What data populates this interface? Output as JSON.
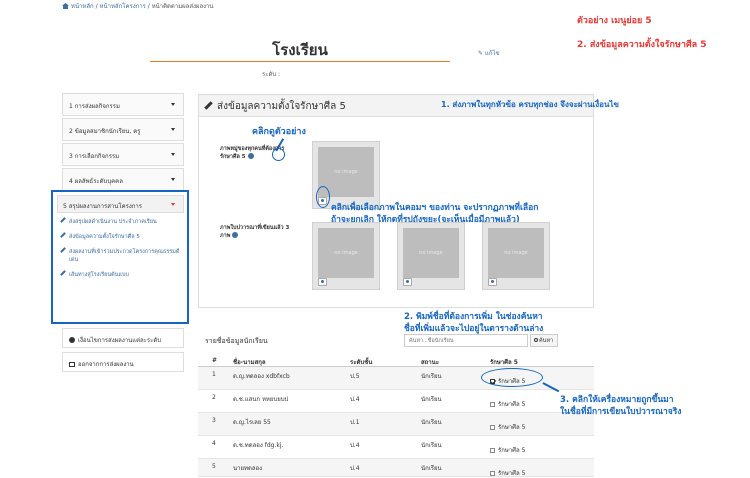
{
  "breadcrumb": {
    "home": "หน้าหลัก",
    "projects": "หน้าหลักโครงการ",
    "current": "หน้าติดตามผลส่งผลงาน",
    "sep": " / "
  },
  "annotations": {
    "example_submenu": "ตัวอย่าง เมนูย่อย 5",
    "step2_top": "2. ส่งข้อมูลความตั้งใจรักษาศีล 5",
    "step1": "1. ส่งภาพในทุกหัวข้อ ครบทุกช่อง จึงจะผ่านเงื่อนไข",
    "click_example": "คลิกดูตัวอย่าง",
    "click_select_line1": "คลิกเพื่อเลือกภาพในคอมฯ ของท่าน จะปรากฏภาพที่เลือก",
    "click_select_line2": "ถ้าจะยกเลิก ให้กดที่รูปถังขยะ(จะเห็นเมื่อมีภาพแล้ว)",
    "step2_search_line1": "2. พิมพ์ชื่อที่ต้องการเพิ่ม ในช่องค้นหา",
    "step2_search_line2": "ชื่อที่เพิ่มแล้วจะไปอยู่ในตารางด้านล่าง",
    "step3_line1": "3. คลิกให้เครื่องหมายถูกขึ้นมา",
    "step3_line2": "ในชื่อที่มีการเขียนใบปวารณาจริง"
  },
  "header": {
    "title": "โรงเรียน",
    "edit_label": "แก้ไข",
    "level_label": "ระดับ :"
  },
  "sidebar": {
    "items": [
      {
        "label": "1 การส่งผลกิจกรรม"
      },
      {
        "label": "2 ข้อมูลสมาชิกนักเรียน, ครู"
      },
      {
        "label": "3 การเลือกกิจกรรม"
      },
      {
        "label": "4 ผลลัพธ์ระดับบุคคล"
      }
    ],
    "open_item": {
      "label": "5 สรุปผลงานการสานโครงการ",
      "sub_links": [
        {
          "label": "ส่งสรุปผลดำเนินงาน ประจำภาคเรียน"
        },
        {
          "label": "ส่งข้อมูลความตั้งใจรักษาศีล 5"
        },
        {
          "label": "ส่งผลงานที่เข้าร่วมประกวดโครงการคุณธรรมดีเด่น"
        },
        {
          "label": "เส้นทางสู่โรงเรียนต้นแบบ"
        }
      ]
    },
    "conditions_button": "เงื่อนไขการส่งผลงานแต่ละระดับ",
    "exit_button": "ออกจากการส่งผลงาน"
  },
  "panel": {
    "title": "ส่งข้อมูลความตั้งใจรักษาศีล 5",
    "field1_label": "ภาพหมู่ของทุกคนที่ต้องการรักษาศีล 5",
    "field2_label": "ภาพใบปวารณาที่เขียนแล้ว 3 ภาพ",
    "no_image": "no image"
  },
  "students": {
    "title": "รายชื่อข้อมูลนักเรียน",
    "search_placeholder": "ค้นหา...ชื่อนักเรียน",
    "search_button": "ค้นหา",
    "columns": {
      "num": "#",
      "name": "ชื่อ-นามสกุล",
      "grade": "ระดับชั้น",
      "status": "สถานะ",
      "precept": "รักษาศีล 5"
    },
    "rows": [
      {
        "num": "1",
        "name": "ด.ญ.ทดลอง xdbfxcb",
        "grade": "ป.5",
        "status": "นักเรียน",
        "precept": "รักษาศีล 5"
      },
      {
        "num": "2",
        "name": "ด.ช.แสนก หหยบยบป",
        "grade": "ป.4",
        "status": "นักเรียน",
        "precept": "รักษาศีล 5"
      },
      {
        "num": "3",
        "name": "ด.ญ.ไรเลย 55",
        "grade": "ป.1",
        "status": "นักเรียน",
        "precept": "รักษาศีล 5"
      },
      {
        "num": "4",
        "name": "ด.ช.ทดลอง fdg.kj.",
        "grade": "ป.4",
        "status": "นักเรียน",
        "precept": "รักษาศีล 5"
      },
      {
        "num": "5",
        "name": "นายทดลอง",
        "grade": "ป.4",
        "status": "นักเรียน",
        "precept": "รักษาศีล 5"
      }
    ],
    "checked": [
      1,
      0,
      0,
      0,
      0
    ]
  },
  "colors": {
    "annotation_blue": "#1565c0",
    "annotation_red": "#e53935",
    "link_blue": "#3a6ea5",
    "title_rule": "#e67e22"
  }
}
